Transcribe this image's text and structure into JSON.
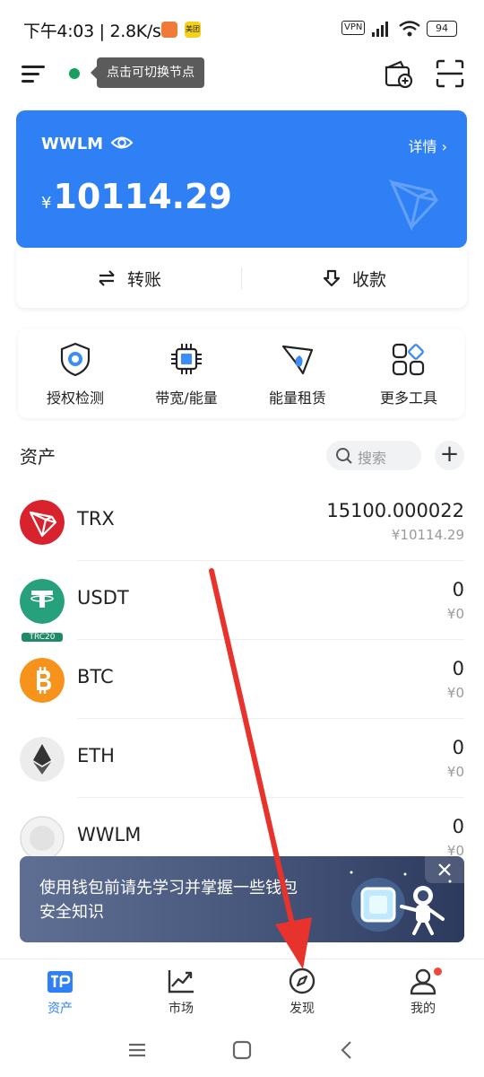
{
  "status_bar": {
    "time": "下午4:03 | 2.8K/s",
    "app2_label": "美团",
    "vpn": "VPN",
    "battery": "94"
  },
  "header": {
    "node_tooltip": "点击可切换节点"
  },
  "wallet": {
    "name": "WWLM",
    "details_label": "详情 ›",
    "currency_symbol": "¥",
    "balance": "10114.29",
    "transfer_label": "转账",
    "receive_label": "收款"
  },
  "tools": [
    {
      "label": "授权检测",
      "icon": "shield-icon"
    },
    {
      "label": "带宽/能量",
      "icon": "chip-icon"
    },
    {
      "label": "能量租赁",
      "icon": "energy-rocket-icon"
    },
    {
      "label": "更多工具",
      "icon": "grid-apps-icon"
    }
  ],
  "assets": {
    "title": "资产",
    "search_placeholder": "搜索",
    "add_label": "+",
    "items": [
      {
        "symbol": "TRX",
        "amount": "15100.000022",
        "value": "¥10114.29",
        "color": "#d8232f",
        "badge": ""
      },
      {
        "symbol": "USDT",
        "amount": "0",
        "value": "¥0",
        "color": "#26a17b",
        "badge": "TRC20"
      },
      {
        "symbol": "BTC",
        "amount": "0",
        "value": "¥0",
        "color": "#f7931a",
        "badge": ""
      },
      {
        "symbol": "ETH",
        "amount": "0",
        "value": "¥0",
        "color": "#ececec",
        "badge": ""
      },
      {
        "symbol": "WWLM",
        "amount": "0",
        "value": "¥0",
        "color": "#e4e4e4",
        "badge": ""
      }
    ]
  },
  "banner": {
    "text": "使用钱包前请先学习并掌握一些钱包安全知识"
  },
  "bottom_nav": [
    {
      "label": "资产",
      "icon": "tp-wallet-icon",
      "active": true
    },
    {
      "label": "市场",
      "icon": "market-chart-icon",
      "active": false
    },
    {
      "label": "发现",
      "icon": "compass-icon",
      "active": false
    },
    {
      "label": "我的",
      "icon": "user-icon",
      "active": false
    }
  ],
  "colors": {
    "primary": "#2f80f5",
    "annotation_arrow": "#e8322c"
  }
}
